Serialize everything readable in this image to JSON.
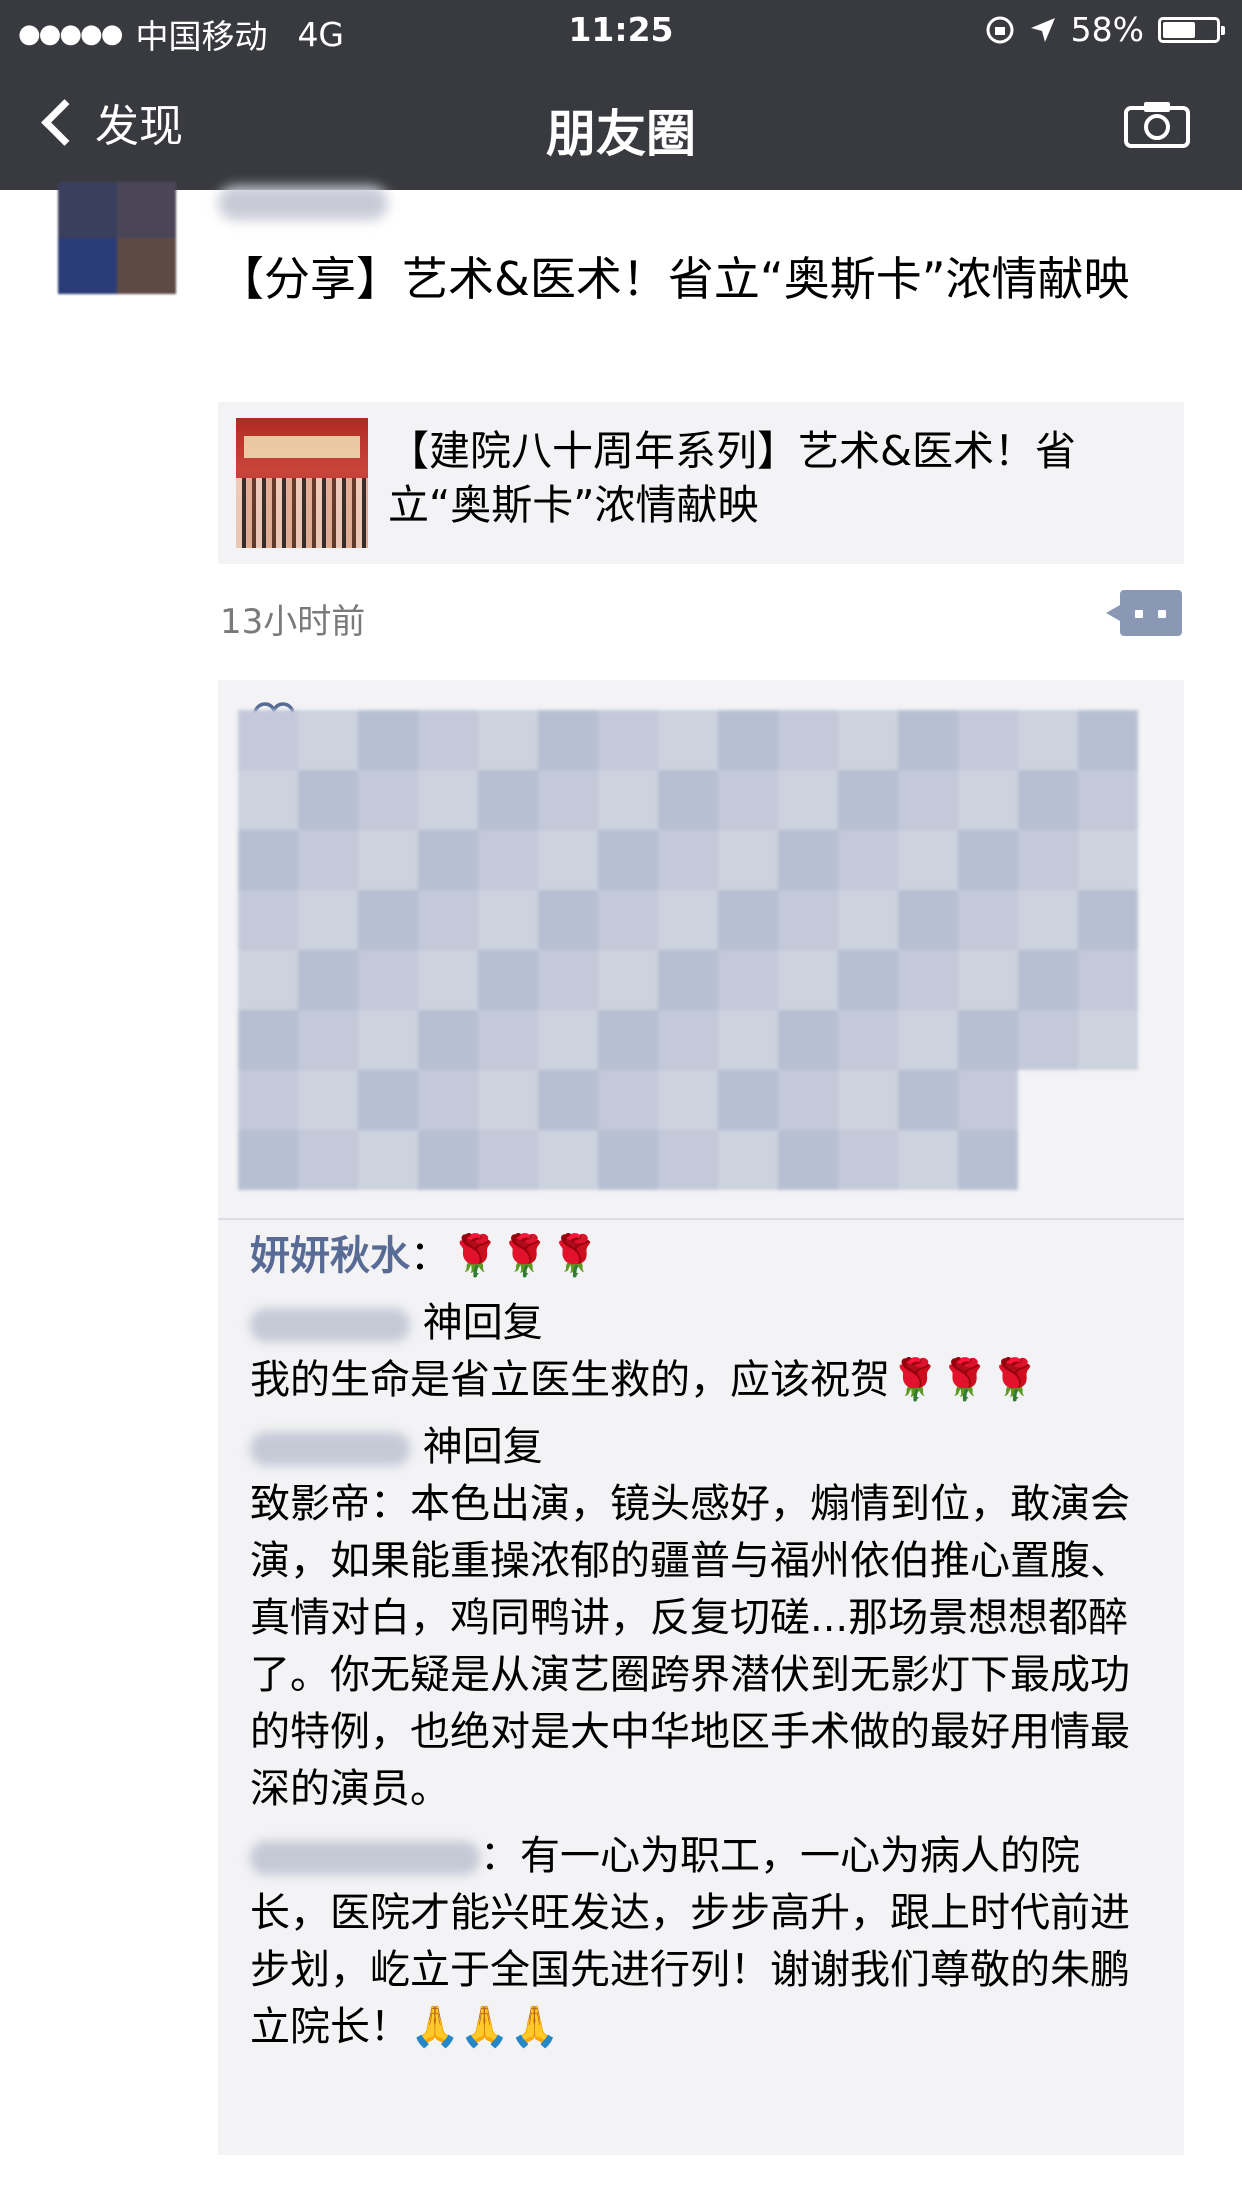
{
  "status_bar": {
    "carrier": "中国移动",
    "network": "4G",
    "time": "11:25",
    "battery": "58%"
  },
  "nav": {
    "back_label": "发现",
    "title": "朋友圈"
  },
  "post": {
    "text": "【分享】艺术&医术！省立“奥斯卡”浓情献映",
    "link_title": "【建院八十周年系列】艺术&医术！省立“奥斯卡”浓情献映",
    "time_ago": "13小时前"
  },
  "comments": [
    {
      "nick": "妍妍秋水",
      "text": "🌹🌹🌹"
    },
    {
      "header": "神回复",
      "text": "我的生命是省立医生救的，应该祝贺🌹🌹🌹"
    },
    {
      "header": "神回复",
      "text": "致影帝：本色出演，镜头感好，煽情到位，敢演会演，如果能重操浓郁的疆普与福州依伯推心置腹、真情对白，鸡同鸭讲，反复切磋...那场景想想都醉了。你无疑是从演艺圈跨界潜伏到无影灯下最成功的特例，也绝对是大中华地区手术做的最好用情最深的演员。"
    },
    {
      "text": "有一心为职工，一心为病人的院长，医院才能兴旺发达，步步高升，跟上时代前进步划，屹立于全国先进行列！谢谢我们尊敬的朱鹏立院长！🙏🙏🙏"
    }
  ],
  "colors": {
    "nav_bg": "#393a3f",
    "nickname": "#576b95",
    "comment_bg": "#f3f3f5"
  },
  "icons": [
    "back-chevron-icon",
    "camera-icon",
    "comment-more-icon",
    "heart-icon",
    "location-arrow-icon",
    "lock-rotation-icon"
  ]
}
